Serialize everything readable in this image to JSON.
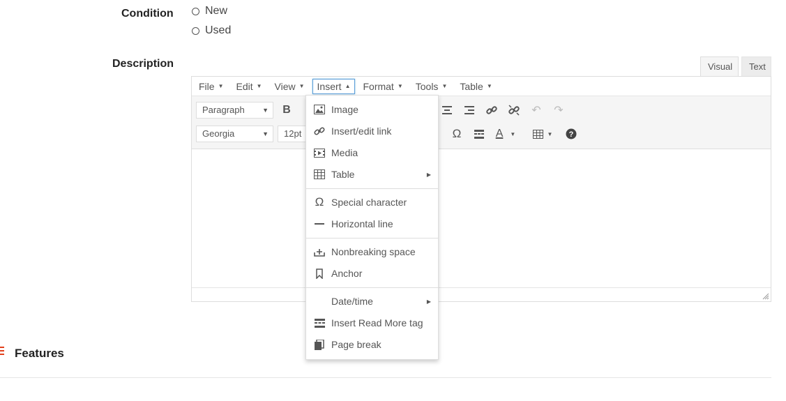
{
  "condition": {
    "label": "Condition",
    "options": [
      "New",
      "Used"
    ]
  },
  "description": {
    "label": "Description",
    "tabs": [
      "Visual",
      "Text"
    ]
  },
  "menubar": [
    "File",
    "Edit",
    "View",
    "Insert",
    "Format",
    "Tools",
    "Table"
  ],
  "toolbar": {
    "block_format": "Paragraph",
    "font_family": "Georgia",
    "font_size": "12pt",
    "bold": "B",
    "special_char": "Ω",
    "text_color": "A"
  },
  "insert_menu": {
    "items": [
      {
        "label": "Image",
        "icon": "image-icon"
      },
      {
        "label": "Insert/edit link",
        "icon": "link-icon"
      },
      {
        "label": "Media",
        "icon": "media-icon"
      },
      {
        "label": "Table",
        "icon": "table-icon",
        "submenu": true
      },
      {
        "label": "Special character",
        "icon": "omega-icon"
      },
      {
        "label": "Horizontal line",
        "icon": "horizontal-line-icon"
      },
      {
        "label": "Nonbreaking space",
        "icon": "nonbreaking-space-icon"
      },
      {
        "label": "Anchor",
        "icon": "bookmark-icon"
      },
      {
        "label": "Date/time",
        "icon": "",
        "submenu": true
      },
      {
        "label": "Insert Read More tag",
        "icon": "read-more-icon"
      },
      {
        "label": "Page break",
        "icon": "page-break-icon"
      }
    ]
  },
  "features": {
    "title": "Features"
  },
  "colors": {
    "accent_blue": "#5b9dd9",
    "features_accent": "#e2401c"
  }
}
